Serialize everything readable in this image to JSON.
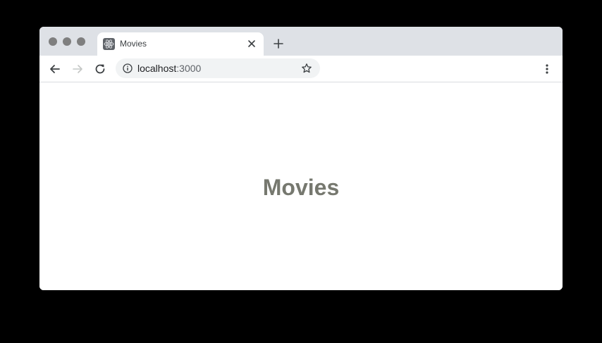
{
  "browser": {
    "tab": {
      "title": "Movies",
      "favicon": "react-logo-icon"
    },
    "toolbar": {
      "url_host": "localhost",
      "url_port": ":3000",
      "icons": [
        "back-arrow-icon",
        "forward-arrow-icon",
        "reload-icon",
        "info-icon",
        "star-icon",
        "kebab-menu-icon"
      ]
    },
    "colors": {
      "tabbar": "#dee1e6",
      "omnibox": "#f1f3f4",
      "traffic_lights": "#7f7f7f"
    }
  },
  "page": {
    "heading": "Movies",
    "heading_color": "#76786f"
  }
}
